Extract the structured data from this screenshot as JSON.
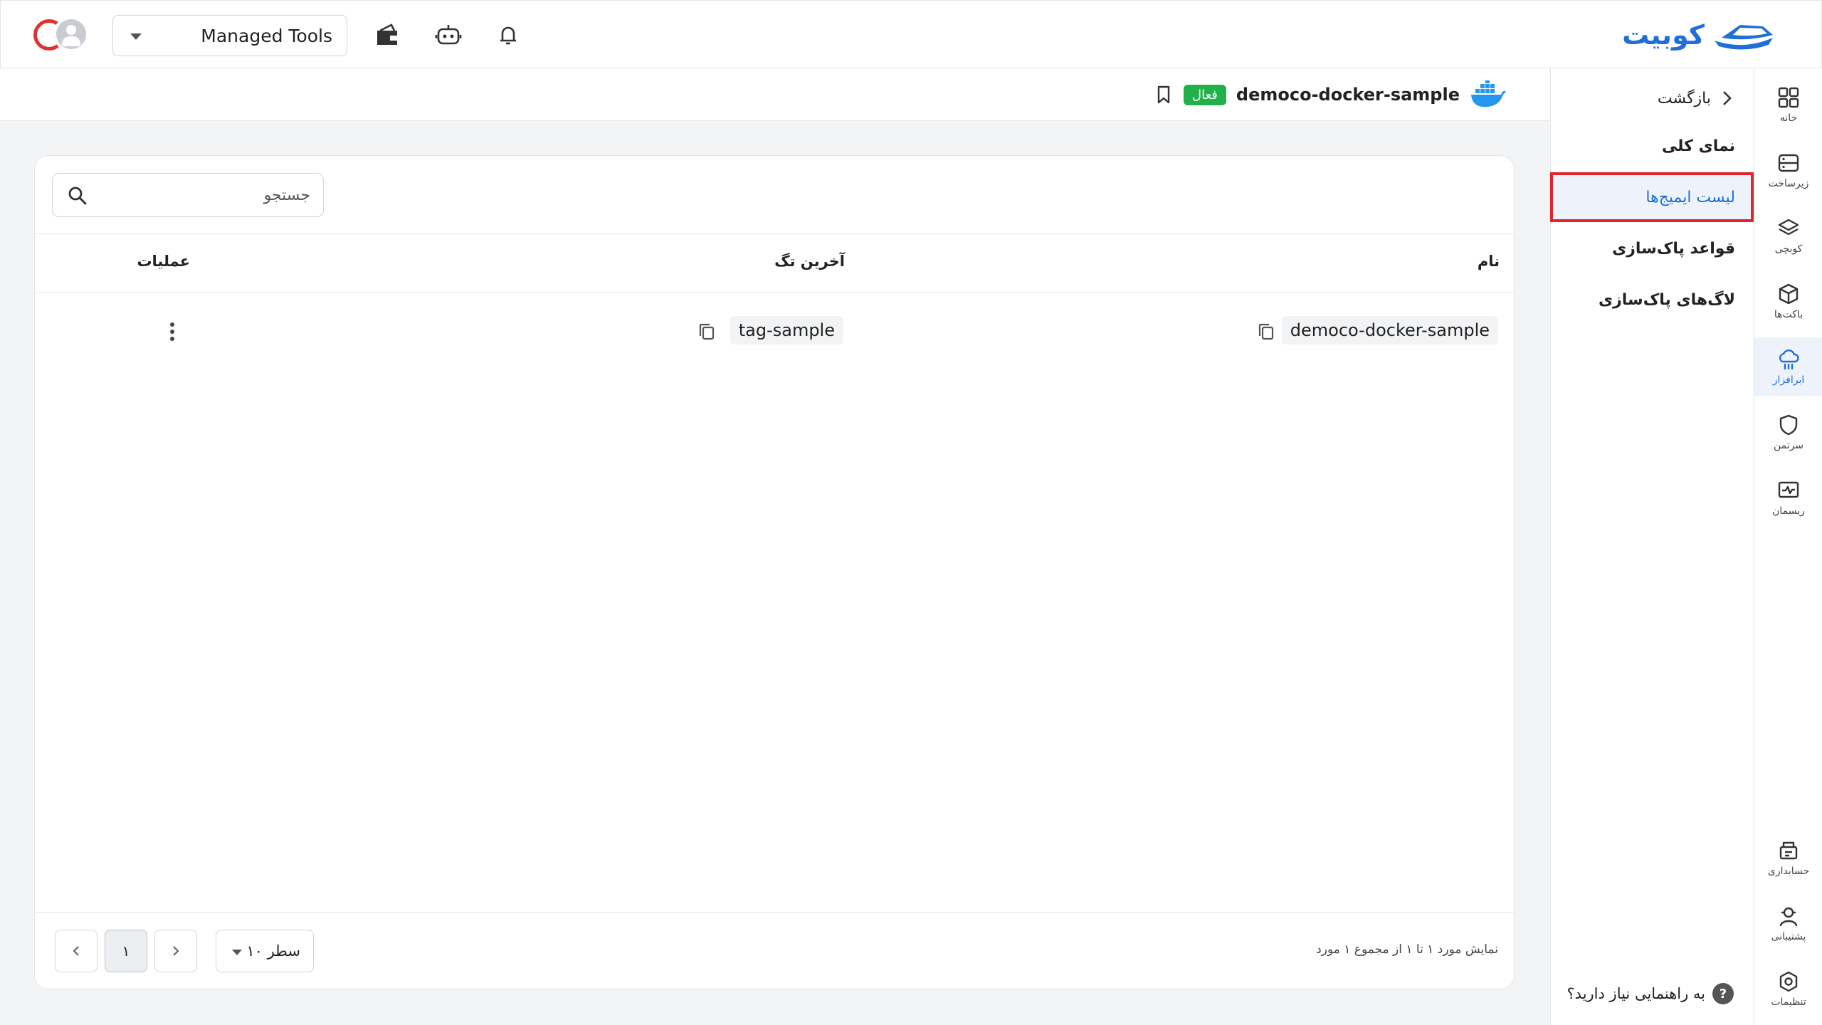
{
  "header": {
    "logo_text": "کوبیت",
    "tool_select": {
      "value": "Managed Tools"
    },
    "icons": [
      "wallet-icon",
      "robot-icon",
      "bell-icon"
    ]
  },
  "rail": {
    "items": [
      {
        "label": "خانه",
        "icon": "grid-icon"
      },
      {
        "label": "زیرساخت",
        "icon": "server-icon"
      },
      {
        "label": "کوبچی",
        "icon": "layers-icon"
      },
      {
        "label": "باکت‌ها",
        "icon": "box-icon"
      },
      {
        "label": "ابرافزار",
        "icon": "cloud-tool-icon",
        "active": true
      },
      {
        "label": "سرتمن",
        "icon": "shield-icon"
      },
      {
        "label": "ریسمان",
        "icon": "monitor-pulse-icon"
      }
    ],
    "bottom_items": [
      {
        "label": "حسابداری",
        "icon": "accounting-icon"
      },
      {
        "label": "پشتیبانی",
        "icon": "support-icon"
      },
      {
        "label": "تنظیمات",
        "icon": "settings-icon"
      }
    ]
  },
  "submenu": {
    "back_label": "بازگشت",
    "items": [
      {
        "label": "نمای کلی"
      },
      {
        "label": "لیست ایمیج‌ها",
        "active": true
      },
      {
        "label": "قواعد پاک‌سازی"
      },
      {
        "label": "لاگ‌های پاک‌سازی"
      }
    ],
    "help_label": "به راهنمایی نیاز دارید؟",
    "help_mark": "?"
  },
  "page": {
    "title": "democo-docker-sample",
    "status_badge": "فعال",
    "accent": "#1f6fd6",
    "status_color": "#22b04b"
  },
  "search": {
    "placeholder": "جستجو"
  },
  "table": {
    "columns": {
      "name": "نام",
      "last_tag": "آخرین تگ",
      "actions": "عملیات"
    },
    "rows": [
      {
        "name": "democo-docker-sample",
        "last_tag": "tag-sample"
      }
    ]
  },
  "footer": {
    "info": "نمایش مورد ۱ تا ۱ از مجموع ۱ مورد",
    "rows_per_page": "۱۰ سطر",
    "current_page": "۱"
  }
}
